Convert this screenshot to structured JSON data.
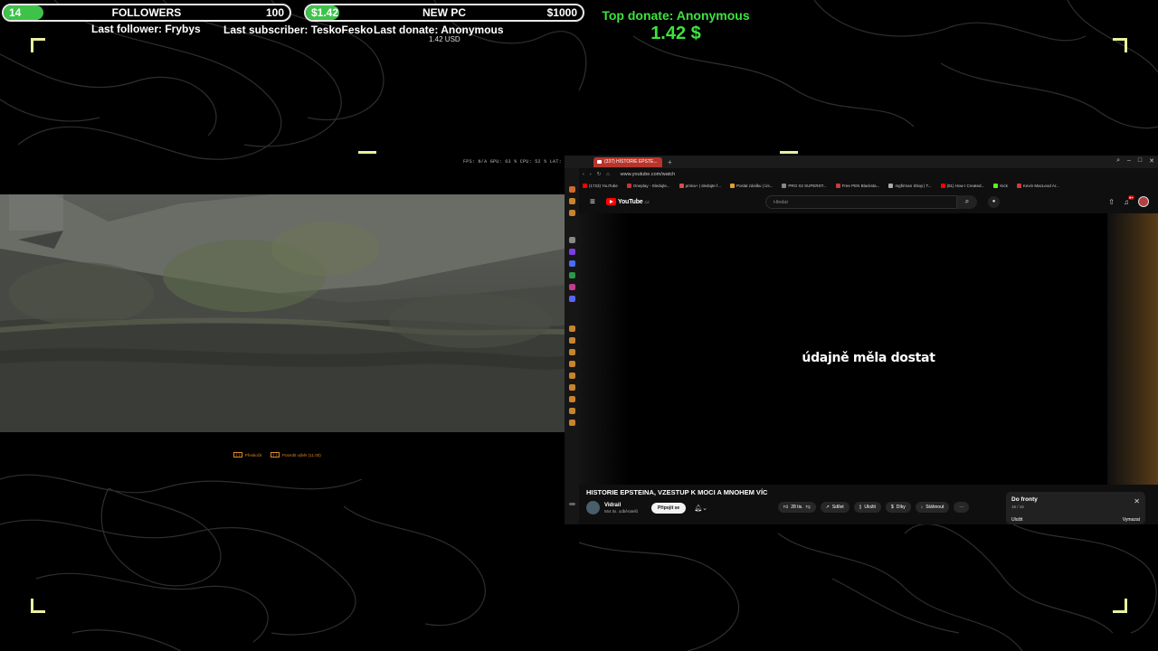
{
  "overlay": {
    "followers_goal": {
      "current": "14",
      "title": "FOLLOWERS",
      "target": "100",
      "progress": 0.14
    },
    "donation_goal": {
      "current": "$1.42",
      "title": "NEW PC",
      "target": "$1000",
      "progress": 0.01
    },
    "last_follower": "Last follower: Frybys",
    "last_subscriber": "Last subscriber: TeskoFesko",
    "last_donate": "Last donate: Anonymous",
    "last_donate_amount": "1.42 USD",
    "top_donate_label": "Top donate: Anonymous",
    "top_donate_amount": "1.42 $",
    "accent_color": "#3ec24a",
    "bracket_color": "#e8f0a0"
  },
  "game": {
    "hud": "FPS: N/A  GPU: 63 %  CPU: 52 %  LAT: N/A",
    "prompt_1_key": "[ ]",
    "prompt_1_label": "Přeskočit",
    "prompt_2_key": "[  ]",
    "prompt_2_label": "Potvrdit výběr (11.00)"
  },
  "browser": {
    "tab_title": "(337) HISTORIE EPSTE...",
    "url": "www.youtube.com/watch",
    "bookmarks": [
      "(1723) YouTube",
      "Oneplay - Sledujte...",
      "prima+ | sledujte f...",
      "Poslat zásilku | Ús...",
      "PRO X2 SUPERST...",
      "Free PEN Blacksta...",
      "mgfirman Shop | T...",
      "(81) How I Created...",
      "Kick",
      "Kevin MacLeod Ar..."
    ],
    "youtube": {
      "logo": "YouTube",
      "logo_region": "CZ",
      "search_placeholder": "Hledat",
      "notifications": "9+",
      "subtitle": "údajně měla dostat",
      "video_title": "HISTORIE EPSTEINA, VZESTUP K MOCI A MNOHEM VÍC",
      "channel_name": "Vidrail",
      "channel_subs": "554 tis. odběratelů",
      "join_label": "Připojit se",
      "like_count": "28 tis.",
      "share": "Sdílet",
      "save": "Uložit",
      "thanks": "Díky",
      "download": "Stáhnout",
      "queue_title": "Do fronty",
      "queue_count": "16 / 16",
      "queue_save": "Uložit",
      "queue_clear": "Vymazat"
    }
  }
}
